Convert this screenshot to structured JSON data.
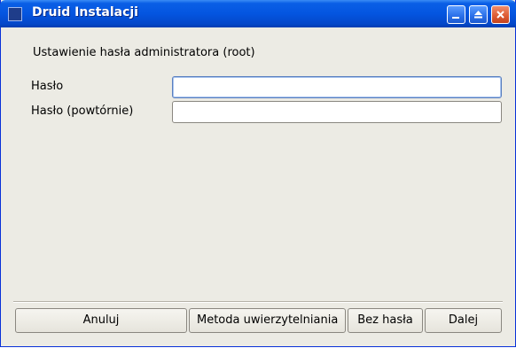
{
  "window": {
    "title": "Druid Instalacji"
  },
  "titlebar_buttons": {
    "minimize": "minimize-icon",
    "maximize": "maximize-icon",
    "close": "close-icon"
  },
  "form": {
    "heading": "Ustawienie hasła administratora (root)",
    "password_label": "Hasło",
    "password_value": "",
    "password_repeat_label": "Hasło (powtórnie)",
    "password_repeat_value": ""
  },
  "buttons": {
    "cancel": "Anuluj",
    "auth_method": "Metoda uwierzytelniania",
    "no_password": "Bez hasła",
    "next": "Dalej"
  },
  "colors": {
    "titlebar": "#0455e0",
    "window_bg": "#ecebe4",
    "close_button": "#dc5a32"
  }
}
